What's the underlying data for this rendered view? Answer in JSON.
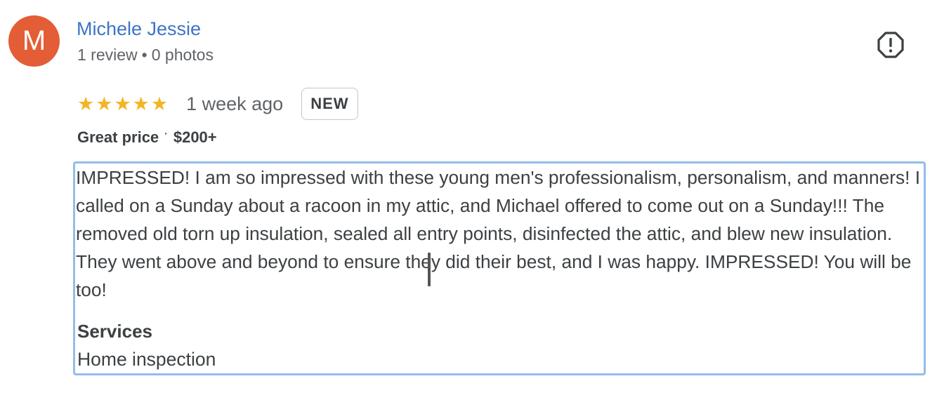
{
  "reviewer": {
    "avatar_letter": "M",
    "avatar_color": "#e35d36",
    "name": "Michele Jessie",
    "review_count": "1 review",
    "separator": "•",
    "photo_count": "0 photos"
  },
  "report": {
    "icon": "report-flag-icon"
  },
  "rating": {
    "stars": 5,
    "star_glyph": "★",
    "star_color": "#f2b623",
    "time_ago": "1 week ago",
    "badge": "NEW"
  },
  "price": {
    "label": "Great price",
    "separator": "·",
    "amount": "$200+"
  },
  "review": {
    "text": "IMPRESSED! I am so impressed with these young men's professionalism, personalism, and manners! I called on a Sunday about a racoon in my attic, and Michael offered to come out on a Sunday!!! The removed old torn up insulation, sealed all entry points, disinfected the attic, and blew new insulation. They went above and beyond to ensure they did their best, and I was happy. IMPRESSED! You will be too!",
    "highlight_color": "#93bde9"
  },
  "services": {
    "title": "Services",
    "value": "Home inspection"
  }
}
